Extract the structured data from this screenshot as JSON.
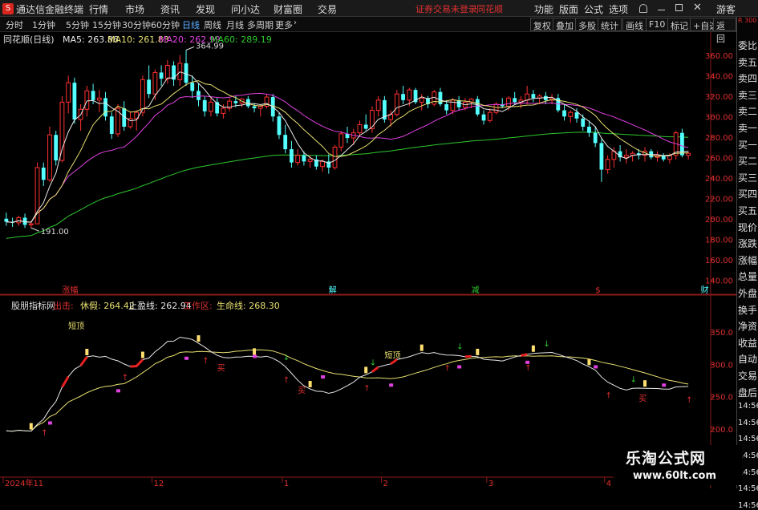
{
  "app": {
    "title": "通达信金融终端",
    "logo": "S"
  },
  "menu": [
    "行情",
    "市场",
    "资讯",
    "发现",
    "问小达",
    "财富圈",
    "交易"
  ],
  "login_warning": "证券交易未登录",
  "broker": "同花顺",
  "menu_right": [
    "功能",
    "版面",
    "公式",
    "选项"
  ],
  "guest": "游客",
  "periods": [
    "分时",
    "1分钟",
    "5分钟",
    "15分钟",
    "30分钟",
    "60分钟",
    "日线",
    "周线",
    "月线",
    "多周期",
    "更多"
  ],
  "active_period": "日线",
  "tool_buttons": [
    "复权",
    "叠加",
    "多股",
    "统计",
    "画线",
    "F10",
    "标记",
    "+自选",
    "返回"
  ],
  "side_labels": [
    "委比",
    "卖五",
    "卖四",
    "卖三",
    "卖二",
    "卖一",
    "买一",
    "买二",
    "买三",
    "买四",
    "买五",
    "现价",
    "涨跌",
    "涨幅",
    "总量",
    "外盘",
    "换手",
    "净资",
    "收益",
    "自动",
    "交易",
    "盘后",
    "14:56",
    "14:56",
    "14:56",
    "14:56",
    "14:56",
    "14:56",
    "14:56"
  ],
  "side_top_text": "R 300",
  "main_legend": {
    "stock": "同花顺(日线)",
    "ma5": "MA5: 263.86",
    "ma10": "MA10: 261.83",
    "ma20": "MA20: 262.99",
    "ma60": "MA60: 289.19"
  },
  "sub_legend": {
    "name": "股朋指标网",
    "a": "出击:",
    "b": "休假: 264.42",
    "c": "止盈线: 262.94",
    "d": "工作区:",
    "e": "生命线: 268.30"
  },
  "colors": {
    "up": "#ff3030",
    "down": "#54ffff",
    "ma5": "#e8e8e8",
    "ma10": "#e8e070",
    "ma20": "#e040e0",
    "ma60": "#2ec82e"
  },
  "watermark": {
    "title": "乐淘公式网",
    "url": "www.60lt.com"
  },
  "chart_data": {
    "type": "candlestick",
    "y_axis": {
      "min": 130,
      "max": 370,
      "ticks": [
        140,
        160,
        180,
        200,
        220,
        240,
        260,
        280,
        300,
        320,
        340,
        360
      ]
    },
    "sub_y_axis": {
      "min": 175,
      "max": 380,
      "ticks": [
        200,
        250,
        300,
        350
      ]
    },
    "x_labels": [
      {
        "label": "2024年11",
        "i": 0
      },
      {
        "label": "12",
        "i": 24
      },
      {
        "label": "1",
        "i": 45
      },
      {
        "label": "2",
        "i": 61
      },
      {
        "label": "3",
        "i": 78
      },
      {
        "label": "4",
        "i": 97
      }
    ],
    "annotations": {
      "high": "364.99",
      "low": "191.00",
      "high_i": 29,
      "low_i": 4
    },
    "events": [
      {
        "label": "涨幅",
        "i": 9,
        "color": "#e03030"
      },
      {
        "label": "解",
        "i": 52,
        "color": "#54ffff"
      },
      {
        "label": "减",
        "i": 75,
        "color": "#2ec82e"
      },
      {
        "label": "$",
        "i": 95,
        "color": "#e03030"
      },
      {
        "label": "财",
        "i": 112,
        "color": "#54ffff"
      }
    ],
    "sub_labels": [
      {
        "text": "短顶",
        "i": 10,
        "v": 355,
        "color": "#e8e070"
      },
      {
        "text": "短顶",
        "i": 61,
        "v": 310,
        "color": "#e8e070"
      },
      {
        "text": "买",
        "i": 47,
        "v": 255,
        "color": "#e03030"
      },
      {
        "text": "买",
        "i": 34,
        "v": 290,
        "color": "#e03030"
      },
      {
        "text": "买",
        "i": 102,
        "v": 243,
        "color": "#e03030"
      }
    ],
    "ma60_start": 180,
    "ohlc": [
      [
        200,
        206,
        193,
        197
      ],
      [
        197,
        201,
        192,
        196
      ],
      [
        196,
        203,
        193,
        201
      ],
      [
        201,
        205,
        191,
        194
      ],
      [
        194,
        198,
        191,
        195
      ],
      [
        195,
        255,
        195,
        250
      ],
      [
        250,
        255,
        232,
        238
      ],
      [
        238,
        290,
        236,
        282
      ],
      [
        282,
        286,
        252,
        257
      ],
      [
        257,
        320,
        255,
        314
      ],
      [
        314,
        340,
        303,
        333
      ],
      [
        333,
        338,
        293,
        297
      ],
      [
        297,
        312,
        286,
        307
      ],
      [
        307,
        330,
        300,
        325
      ],
      [
        325,
        332,
        312,
        316
      ],
      [
        316,
        326,
        304,
        318
      ],
      [
        318,
        324,
        296,
        300
      ],
      [
        300,
        304,
        278,
        283
      ],
      [
        283,
        312,
        280,
        308
      ],
      [
        308,
        315,
        286,
        290
      ],
      [
        290,
        305,
        288,
        298
      ],
      [
        298,
        306,
        286,
        304
      ],
      [
        304,
        340,
        300,
        336
      ],
      [
        336,
        350,
        318,
        322
      ],
      [
        322,
        346,
        316,
        343
      ],
      [
        343,
        350,
        330,
        337
      ],
      [
        337,
        355,
        332,
        350
      ],
      [
        350,
        354,
        330,
        336
      ],
      [
        336,
        360,
        330,
        352
      ],
      [
        352,
        365,
        330,
        333
      ],
      [
        333,
        340,
        318,
        325
      ],
      [
        325,
        332,
        310,
        316
      ],
      [
        316,
        320,
        300,
        305
      ],
      [
        305,
        318,
        300,
        314
      ],
      [
        314,
        318,
        300,
        303
      ],
      [
        303,
        312,
        298,
        308
      ],
      [
        308,
        318,
        305,
        315
      ],
      [
        315,
        320,
        309,
        313
      ],
      [
        313,
        318,
        309,
        317
      ],
      [
        317,
        320,
        308,
        310
      ],
      [
        310,
        313,
        304,
        308
      ],
      [
        308,
        312,
        300,
        310
      ],
      [
        310,
        322,
        308,
        319
      ],
      [
        319,
        322,
        295,
        300
      ],
      [
        300,
        304,
        278,
        282
      ],
      [
        282,
        292,
        264,
        268
      ],
      [
        268,
        276,
        250,
        255
      ],
      [
        255,
        268,
        252,
        262
      ],
      [
        262,
        266,
        252,
        256
      ],
      [
        256,
        262,
        250,
        258
      ],
      [
        258,
        262,
        248,
        251
      ],
      [
        251,
        258,
        246,
        256
      ],
      [
        256,
        263,
        244,
        250
      ],
      [
        250,
        272,
        248,
        270
      ],
      [
        270,
        286,
        266,
        283
      ],
      [
        283,
        290,
        274,
        279
      ],
      [
        279,
        288,
        272,
        284
      ],
      [
        284,
        296,
        280,
        292
      ],
      [
        292,
        302,
        286,
        288
      ],
      [
        288,
        310,
        284,
        306
      ],
      [
        306,
        320,
        300,
        316
      ],
      [
        316,
        320,
        294,
        297
      ],
      [
        297,
        306,
        290,
        302
      ],
      [
        302,
        326,
        300,
        322
      ],
      [
        322,
        330,
        312,
        316
      ],
      [
        316,
        328,
        310,
        326
      ],
      [
        326,
        328,
        312,
        314
      ],
      [
        314,
        322,
        306,
        318
      ],
      [
        318,
        320,
        308,
        312
      ],
      [
        312,
        326,
        310,
        324
      ],
      [
        324,
        328,
        310,
        312
      ],
      [
        312,
        316,
        302,
        306
      ],
      [
        306,
        318,
        302,
        316
      ],
      [
        316,
        320,
        306,
        309
      ],
      [
        309,
        318,
        306,
        314
      ],
      [
        314,
        318,
        308,
        317
      ],
      [
        317,
        320,
        300,
        302
      ],
      [
        302,
        306,
        292,
        296
      ],
      [
        296,
        308,
        294,
        304
      ],
      [
        304,
        314,
        302,
        312
      ],
      [
        312,
        318,
        308,
        310
      ],
      [
        310,
        320,
        306,
        318
      ],
      [
        318,
        324,
        312,
        314
      ],
      [
        314,
        320,
        308,
        316
      ],
      [
        316,
        330,
        312,
        322
      ],
      [
        322,
        326,
        314,
        318
      ],
      [
        318,
        322,
        312,
        320
      ],
      [
        320,
        324,
        312,
        316
      ],
      [
        316,
        322,
        312,
        318
      ],
      [
        318,
        322,
        304,
        306
      ],
      [
        306,
        312,
        296,
        300
      ],
      [
        300,
        306,
        294,
        304
      ],
      [
        304,
        308,
        294,
        298
      ],
      [
        298,
        302,
        286,
        290
      ],
      [
        290,
        296,
        280,
        284
      ],
      [
        284,
        290,
        270,
        274
      ],
      [
        274,
        278,
        236,
        248
      ],
      [
        248,
        262,
        244,
        258
      ],
      [
        258,
        270,
        250,
        266
      ],
      [
        266,
        272,
        256,
        260
      ],
      [
        260,
        268,
        254,
        262
      ],
      [
        262,
        266,
        256,
        264
      ],
      [
        264,
        268,
        258,
        262
      ],
      [
        262,
        270,
        256,
        266
      ],
      [
        266,
        268,
        258,
        260
      ],
      [
        260,
        266,
        256,
        262
      ],
      [
        262,
        264,
        256,
        258
      ],
      [
        258,
        264,
        254,
        262
      ],
      [
        262,
        286,
        258,
        284
      ],
      [
        284,
        288,
        260,
        262
      ],
      [
        262,
        266,
        258,
        264
      ]
    ]
  }
}
